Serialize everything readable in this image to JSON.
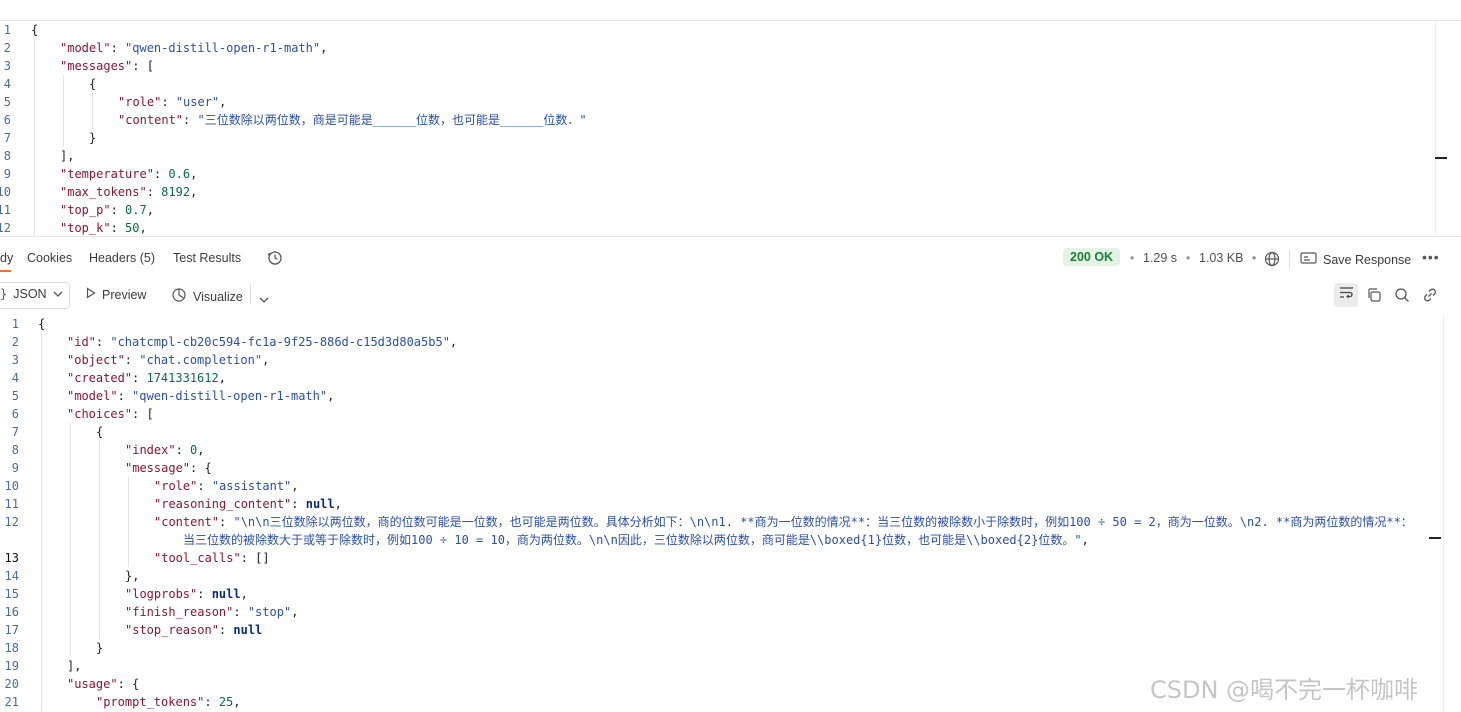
{
  "request_editor": {
    "lines": [
      {
        "n": "1",
        "tokens": [
          [
            "p",
            "{"
          ]
        ]
      },
      {
        "n": "2",
        "tokens": [
          [
            "k",
            "\"model\""
          ],
          [
            "p",
            ": "
          ],
          [
            "s",
            "\"qwen-distill-open-r1-math\""
          ],
          [
            "p",
            ","
          ]
        ]
      },
      {
        "n": "3",
        "tokens": [
          [
            "k",
            "\"messages\""
          ],
          [
            "p",
            ": ["
          ]
        ]
      },
      {
        "n": "4",
        "tokens": [
          [
            "p",
            "{"
          ]
        ]
      },
      {
        "n": "5",
        "tokens": [
          [
            "k",
            "\"role\""
          ],
          [
            "p",
            ": "
          ],
          [
            "s",
            "\"user\""
          ],
          [
            "p",
            ","
          ]
        ]
      },
      {
        "n": "6",
        "tokens": [
          [
            "k",
            "\"content\""
          ],
          [
            "p",
            ": "
          ],
          [
            "s",
            "\"三位数除以两位数，商是可能是______位数，也可能是______位数．\""
          ]
        ]
      },
      {
        "n": "7",
        "tokens": [
          [
            "p",
            "}"
          ]
        ]
      },
      {
        "n": "8",
        "tokens": [
          [
            "p",
            "],"
          ]
        ]
      },
      {
        "n": "9",
        "tokens": [
          [
            "k",
            "\"temperature\""
          ],
          [
            "p",
            ": "
          ],
          [
            "n",
            "0.6"
          ],
          [
            "p",
            ","
          ]
        ]
      },
      {
        "n": "10",
        "tokens": [
          [
            "k",
            "\"max_tokens\""
          ],
          [
            "p",
            ": "
          ],
          [
            "n",
            "8192"
          ],
          [
            "p",
            ","
          ]
        ]
      },
      {
        "n": "11",
        "tokens": [
          [
            "k",
            "\"top_p\""
          ],
          [
            "p",
            ": "
          ],
          [
            "n",
            "0.7"
          ],
          [
            "p",
            ","
          ]
        ]
      },
      {
        "n": "12",
        "tokens": [
          [
            "k",
            "\"top_k\""
          ],
          [
            "p",
            ": "
          ],
          [
            "n",
            "50"
          ],
          [
            "p",
            ","
          ]
        ]
      }
    ]
  },
  "response_tabs": {
    "body": "dy",
    "cookies": "Cookies",
    "headers": "Headers (5)",
    "test_results": "Test Results"
  },
  "response_meta": {
    "status": "200 OK",
    "time": "1.29 s",
    "size": "1.03 KB",
    "save_response": "Save Response",
    "status_color": "#1e7e34",
    "status_bg": "#e3f4e6"
  },
  "response_toolbar": {
    "format": "JSON",
    "preview": "Preview",
    "visualize": "Visualize"
  },
  "response_body": {
    "lines": [
      {
        "n": "1",
        "tokens": [
          [
            "p",
            "{"
          ]
        ]
      },
      {
        "n": "2",
        "tokens": [
          [
            "k",
            "\"id\""
          ],
          [
            "p",
            ": "
          ],
          [
            "s",
            "\"chatcmpl-cb20c594-fc1a-9f25-886d-c15d3d80a5b5\""
          ],
          [
            "p",
            ","
          ]
        ]
      },
      {
        "n": "3",
        "tokens": [
          [
            "k",
            "\"object\""
          ],
          [
            "p",
            ": "
          ],
          [
            "s",
            "\"chat.completion\""
          ],
          [
            "p",
            ","
          ]
        ]
      },
      {
        "n": "4",
        "tokens": [
          [
            "k",
            "\"created\""
          ],
          [
            "p",
            ": "
          ],
          [
            "n",
            "1741331612"
          ],
          [
            "p",
            ","
          ]
        ]
      },
      {
        "n": "5",
        "tokens": [
          [
            "k",
            "\"model\""
          ],
          [
            "p",
            ": "
          ],
          [
            "s",
            "\"qwen-distill-open-r1-math\""
          ],
          [
            "p",
            ","
          ]
        ]
      },
      {
        "n": "6",
        "tokens": [
          [
            "k",
            "\"choices\""
          ],
          [
            "p",
            ": ["
          ]
        ]
      },
      {
        "n": "7",
        "tokens": [
          [
            "p",
            "{"
          ]
        ]
      },
      {
        "n": "8",
        "tokens": [
          [
            "k",
            "\"index\""
          ],
          [
            "p",
            ": "
          ],
          [
            "n",
            "0"
          ],
          [
            "p",
            ","
          ]
        ]
      },
      {
        "n": "9",
        "tokens": [
          [
            "k",
            "\"message\""
          ],
          [
            "p",
            ": {"
          ]
        ]
      },
      {
        "n": "10",
        "tokens": [
          [
            "k",
            "\"role\""
          ],
          [
            "p",
            ": "
          ],
          [
            "s",
            "\"assistant\""
          ],
          [
            "p",
            ","
          ]
        ]
      },
      {
        "n": "11",
        "tokens": [
          [
            "k",
            "\"reasoning_content\""
          ],
          [
            "p",
            ": "
          ],
          [
            "nl",
            "null"
          ],
          [
            "p",
            ","
          ]
        ]
      },
      {
        "n": "12",
        "tokens": [
          [
            "k",
            "\"content\""
          ],
          [
            "p",
            ": "
          ],
          [
            "s",
            "\"\\n\\n三位数除以两位数，商的位数可能是一位数，也可能是两位数。具体分析如下：\\n\\n1. **商为一位数的情况**：当三位数的被除数小于除数时，例如100 ÷ 50 = 2，商为一位数。\\n2. **商为两位数的情况**："
          ]
        ]
      },
      {
        "n": "",
        "tokens": [
          [
            "s",
            "当三位数的被除数大于或等于除数时，例如100 ÷ 10 = 10，商为两位数。\\n\\n因此，三位数除以两位数，商可能是\\\\boxed{1}位数，也可能是\\\\boxed{2}位数。\""
          ],
          [
            "p",
            ","
          ]
        ]
      },
      {
        "n": "13",
        "tokens": [
          [
            "k",
            "\"tool_calls\""
          ],
          [
            "p",
            ": []"
          ]
        ]
      },
      {
        "n": "14",
        "tokens": [
          [
            "p",
            "},"
          ]
        ]
      },
      {
        "n": "15",
        "tokens": [
          [
            "k",
            "\"logprobs\""
          ],
          [
            "p",
            ": "
          ],
          [
            "nl",
            "null"
          ],
          [
            "p",
            ","
          ]
        ]
      },
      {
        "n": "16",
        "tokens": [
          [
            "k",
            "\"finish_reason\""
          ],
          [
            "p",
            ": "
          ],
          [
            "s",
            "\"stop\""
          ],
          [
            "p",
            ","
          ]
        ]
      },
      {
        "n": "17",
        "tokens": [
          [
            "k",
            "\"stop_reason\""
          ],
          [
            "p",
            ": "
          ],
          [
            "nl",
            "null"
          ]
        ]
      },
      {
        "n": "18",
        "tokens": [
          [
            "p",
            "}"
          ]
        ]
      },
      {
        "n": "19",
        "tokens": [
          [
            "p",
            "],"
          ]
        ]
      },
      {
        "n": "20",
        "tokens": [
          [
            "k",
            "\"usage\""
          ],
          [
            "p",
            ": {"
          ]
        ]
      },
      {
        "n": "21",
        "tokens": [
          [
            "k",
            "\"prompt_tokens\""
          ],
          [
            "p",
            ": "
          ],
          [
            "n",
            "25"
          ],
          [
            "p",
            ","
          ]
        ]
      }
    ]
  },
  "watermark": "CSDN @喝不完一杯咖啡"
}
